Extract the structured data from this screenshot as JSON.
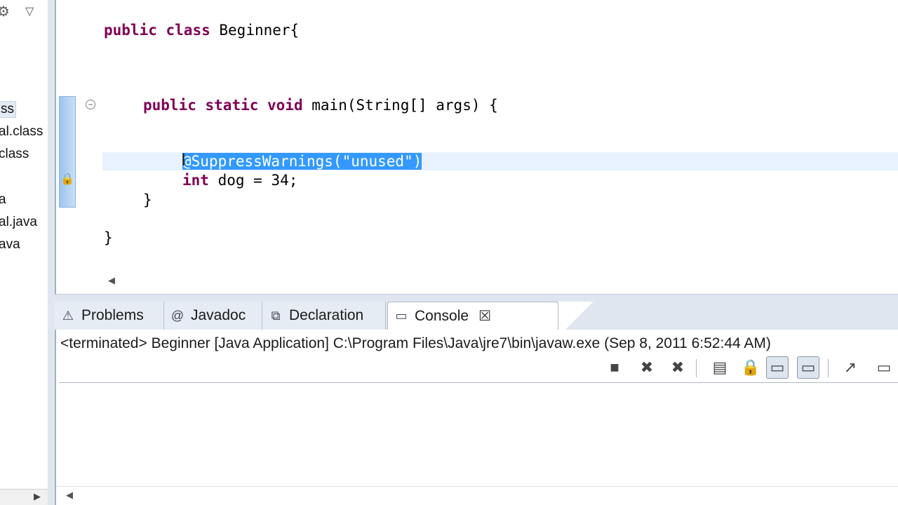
{
  "package_explorer": {
    "items": [
      "ss",
      "al.class",
      "class",
      "a",
      "al.java",
      "ava"
    ],
    "selected_index": 0
  },
  "editor": {
    "lines": {
      "class_decl": {
        "kw1": "public",
        "kw2": "class",
        "rest": "Beginner{"
      },
      "main_decl": {
        "kw1": "public",
        "kw2": "static",
        "kw3": "void",
        "rest": "main(String[] args) {"
      },
      "annotation": "@SuppressWarnings(\"unused\")",
      "int_decl": {
        "kw": "int",
        "rest": "dog = 34;"
      },
      "close_method": "}",
      "close_class": "}"
    },
    "caret_glyph": "I"
  },
  "bottom_tabs": [
    {
      "label": "Problems",
      "icon": "problems-icon",
      "active": false
    },
    {
      "label": "Javadoc",
      "icon": "at-icon",
      "active": false
    },
    {
      "label": "Declaration",
      "icon": "declaration-icon",
      "active": false
    },
    {
      "label": "Console",
      "icon": "console-icon",
      "active": true
    }
  ],
  "console": {
    "status": "<terminated> Beginner [Java Application] C:\\Program Files\\Java\\jre7\\bin\\javaw.exe (Sep 8, 2011 6:52:44 AM)",
    "output": ""
  },
  "colors": {
    "keyword": "#7f0055",
    "selection": "#3399ff",
    "view_background": "#dfe6ef"
  }
}
